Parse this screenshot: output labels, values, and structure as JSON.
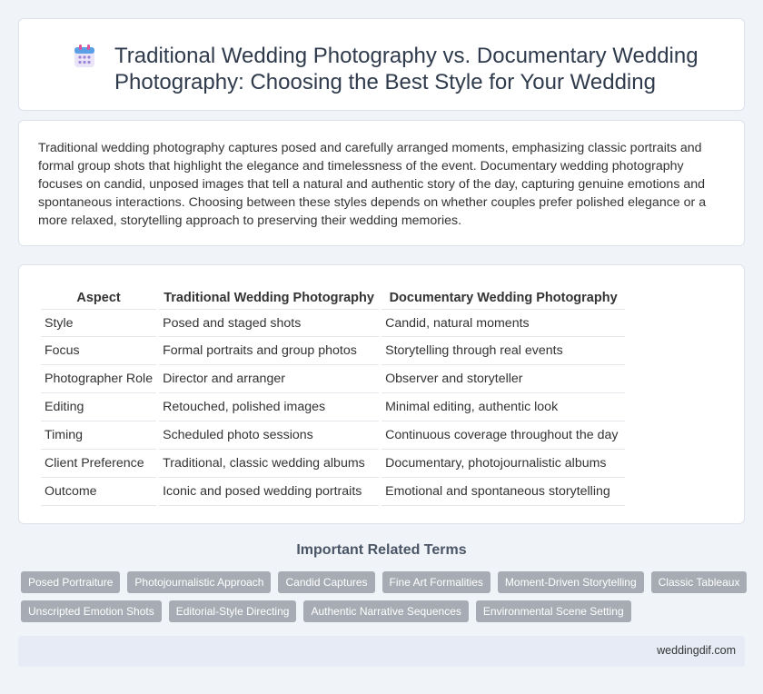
{
  "header": {
    "title": "Traditional Wedding Photography vs. Documentary Wedding Photography: Choosing the Best Style for Your Wedding",
    "icon": "calendar-icon"
  },
  "intro": {
    "text": "Traditional wedding photography captures posed and carefully arranged moments, emphasizing classic portraits and formal group shots that highlight the elegance and timelessness of the event. Documentary wedding photography focuses on candid, unposed images that tell a natural and authentic story of the day, capturing genuine emotions and spontaneous interactions. Choosing between these styles depends on whether couples prefer polished elegance or a more relaxed, storytelling approach to preserving their wedding memories."
  },
  "table": {
    "headers": [
      "Aspect",
      "Traditional Wedding Photography",
      "Documentary Wedding Photography"
    ],
    "rows": [
      [
        "Style",
        "Posed and staged shots",
        "Candid, natural moments"
      ],
      [
        "Focus",
        "Formal portraits and group photos",
        "Storytelling through real events"
      ],
      [
        "Photographer Role",
        "Director and arranger",
        "Observer and storyteller"
      ],
      [
        "Editing",
        "Retouched, polished images",
        "Minimal editing, authentic look"
      ],
      [
        "Timing",
        "Scheduled photo sessions",
        "Continuous coverage throughout the day"
      ],
      [
        "Client Preference",
        "Traditional, classic wedding albums",
        "Documentary, photojournalistic albums"
      ],
      [
        "Outcome",
        "Iconic and posed wedding portraits",
        "Emotional and spontaneous storytelling"
      ]
    ]
  },
  "related": {
    "title": "Important Related Terms",
    "tags": [
      "Posed Portraiture",
      "Photojournalistic Approach",
      "Candid Captures",
      "Fine Art Formalities",
      "Moment-Driven Storytelling",
      "Classic Tableaux",
      "Unscripted Emotion Shots",
      "Editorial-Style Directing",
      "Authentic Narrative Sequences",
      "Environmental Scene Setting"
    ]
  },
  "footer": {
    "brand": "weddingdif.com"
  },
  "colors": {
    "background": "#f0f3f8",
    "tag": "#a6abb4",
    "footer": "#e6ebf5",
    "title": "#2f3b4c"
  }
}
